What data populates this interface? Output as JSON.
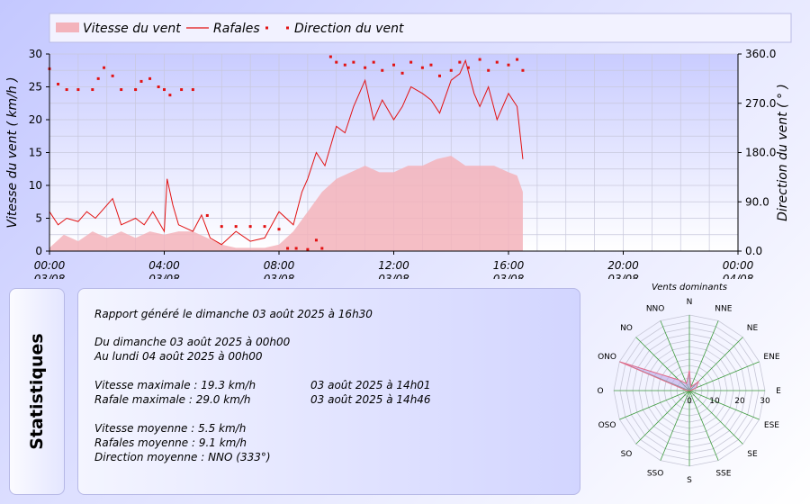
{
  "chart_data": [
    {
      "type": "area",
      "legend": {
        "placement": "top",
        "items": [
          {
            "name": "Vitesse du vent",
            "style": "filled-area",
            "color": "#f3b3bb"
          },
          {
            "name": "Rafales",
            "style": "line",
            "color": "#e21212"
          },
          {
            "name": "Direction du vent",
            "style": "points",
            "color": "#e21212"
          }
        ]
      },
      "ylabel": "Vitesse du vent ( km/h )",
      "ylabel_right": "Direction du vent ( ° )",
      "ylim": [
        0,
        30
      ],
      "ylim_right": [
        0,
        360
      ],
      "yticks": [
        "0",
        "5",
        "10",
        "15",
        "20",
        "25",
        "30"
      ],
      "yticks_right": [
        "0.0",
        "90.0",
        "180.0",
        "270.0",
        "360.0"
      ],
      "xlim_hours": [
        0,
        24
      ],
      "xticks": [
        {
          "time": "00:00",
          "date": "03/08"
        },
        {
          "time": "04:00",
          "date": "03/08"
        },
        {
          "time": "08:00",
          "date": "03/08"
        },
        {
          "time": "12:00",
          "date": "03/08"
        },
        {
          "time": "16:00",
          "date": "03/08"
        },
        {
          "time": "20:00",
          "date": "03/08"
        },
        {
          "time": "00:00",
          "date": "04/08"
        }
      ],
      "grid": true,
      "series": [
        {
          "name": "Vitesse du vent",
          "color": "#f3b3bb",
          "points": [
            [
              0,
              0.5
            ],
            [
              0.5,
              2.5
            ],
            [
              1,
              1.5
            ],
            [
              1.5,
              3
            ],
            [
              2,
              2
            ],
            [
              2.5,
              3
            ],
            [
              3,
              2
            ],
            [
              3.5,
              3
            ],
            [
              4,
              2.5
            ],
            [
              4.5,
              3
            ],
            [
              5,
              3
            ],
            [
              5.5,
              2
            ],
            [
              6,
              1
            ],
            [
              6.5,
              0.5
            ],
            [
              7,
              0.5
            ],
            [
              7.5,
              0.5
            ],
            [
              8,
              1
            ],
            [
              8.5,
              3
            ],
            [
              9,
              6
            ],
            [
              9.5,
              9
            ],
            [
              10,
              11
            ],
            [
              10.5,
              12
            ],
            [
              11,
              13
            ],
            [
              11.5,
              12
            ],
            [
              12,
              12
            ],
            [
              12.5,
              13
            ],
            [
              13,
              13
            ],
            [
              13.5,
              14
            ],
            [
              14,
              14.5
            ],
            [
              14.5,
              13
            ],
            [
              15,
              13
            ],
            [
              15.5,
              13
            ],
            [
              16,
              12
            ],
            [
              16.3,
              11.5
            ],
            [
              16.5,
              9
            ]
          ]
        },
        {
          "name": "Rafales",
          "color": "#e21212",
          "points": [
            [
              0,
              6
            ],
            [
              0.3,
              4
            ],
            [
              0.6,
              5
            ],
            [
              1,
              4.5
            ],
            [
              1.3,
              6
            ],
            [
              1.6,
              5
            ],
            [
              2,
              7
            ],
            [
              2.2,
              8
            ],
            [
              2.5,
              4
            ],
            [
              3,
              5
            ],
            [
              3.3,
              4
            ],
            [
              3.6,
              6
            ],
            [
              4,
              3
            ],
            [
              4.1,
              11
            ],
            [
              4.3,
              7
            ],
            [
              4.5,
              4
            ],
            [
              5,
              3
            ],
            [
              5.3,
              5.5
            ],
            [
              5.6,
              2
            ],
            [
              6,
              1
            ],
            [
              6.5,
              3
            ],
            [
              7,
              1.5
            ],
            [
              7.5,
              2
            ],
            [
              8,
              6
            ],
            [
              8.5,
              4
            ],
            [
              8.8,
              9
            ],
            [
              9,
              11
            ],
            [
              9.3,
              15
            ],
            [
              9.6,
              13
            ],
            [
              10,
              19
            ],
            [
              10.3,
              18
            ],
            [
              10.6,
              22
            ],
            [
              11,
              26
            ],
            [
              11.3,
              20
            ],
            [
              11.6,
              23
            ],
            [
              12,
              20
            ],
            [
              12.3,
              22
            ],
            [
              12.6,
              25
            ],
            [
              13,
              24
            ],
            [
              13.3,
              23
            ],
            [
              13.6,
              21
            ],
            [
              14,
              26
            ],
            [
              14.3,
              27
            ],
            [
              14.5,
              29
            ],
            [
              14.8,
              24
            ],
            [
              15,
              22
            ],
            [
              15.3,
              25
            ],
            [
              15.6,
              20
            ],
            [
              16,
              24
            ],
            [
              16.3,
              22
            ],
            [
              16.5,
              14
            ]
          ]
        },
        {
          "name": "Direction du vent",
          "color": "#e21212",
          "points": [
            [
              0,
              333
            ],
            [
              0.3,
              305
            ],
            [
              0.6,
              295
            ],
            [
              1,
              295
            ],
            [
              1.5,
              295
            ],
            [
              1.7,
              315
            ],
            [
              1.9,
              335
            ],
            [
              2.2,
              320
            ],
            [
              2.5,
              295
            ],
            [
              3,
              295
            ],
            [
              3.2,
              310
            ],
            [
              3.5,
              315
            ],
            [
              3.8,
              300
            ],
            [
              4,
              295
            ],
            [
              4.2,
              285
            ],
            [
              4.6,
              295
            ],
            [
              5,
              295
            ],
            [
              5.5,
              65
            ],
            [
              6,
              45
            ],
            [
              6.5,
              45
            ],
            [
              7,
              45
            ],
            [
              7.5,
              45
            ],
            [
              8,
              40
            ],
            [
              8.3,
              5
            ],
            [
              8.6,
              5
            ],
            [
              9,
              3
            ],
            [
              9.3,
              20
            ],
            [
              9.5,
              5
            ],
            [
              9.8,
              355
            ],
            [
              10,
              345
            ],
            [
              10.3,
              340
            ],
            [
              10.6,
              345
            ],
            [
              11,
              335
            ],
            [
              11.3,
              345
            ],
            [
              11.6,
              330
            ],
            [
              12,
              340
            ],
            [
              12.3,
              325
            ],
            [
              12.6,
              345
            ],
            [
              13,
              335
            ],
            [
              13.3,
              340
            ],
            [
              13.6,
              320
            ],
            [
              14,
              330
            ],
            [
              14.3,
              345
            ],
            [
              14.6,
              335
            ],
            [
              15,
              350
            ],
            [
              15.3,
              330
            ],
            [
              15.6,
              345
            ],
            [
              16,
              340
            ],
            [
              16.3,
              350
            ],
            [
              16.5,
              330
            ]
          ]
        }
      ]
    },
    {
      "type": "radar",
      "title": "Vents dominants",
      "directions": [
        "N",
        "NNE",
        "NE",
        "ENE",
        "E",
        "ESE",
        "SE",
        "SSE",
        "S",
        "SSO",
        "SO",
        "OSO",
        "O",
        "ONO",
        "NO",
        "NNO"
      ],
      "rings": [
        0,
        10,
        20,
        30
      ],
      "ring_labels": [
        "0",
        "10",
        "20",
        "30"
      ],
      "values": [
        8,
        1.5,
        5,
        3,
        0.5,
        0,
        0,
        0,
        0,
        0,
        0,
        0,
        1,
        30,
        6,
        3
      ]
    }
  ],
  "stats": {
    "title": "Statistiques",
    "report_line": "Rapport généré le dimanche 03 août 2025 à 16h30",
    "from_line": "Du dimanche 03 août 2025 à 00h00",
    "to_line": "Au lundi 04 août 2025 à 00h00",
    "max_speed_label": "Vitesse maximale : 19.3 km/h",
    "max_speed_time": "03 août 2025 à 14h01",
    "max_gust_label": "Rafale maximale : 29.0 km/h",
    "max_gust_time": "03 août 2025 à 14h46",
    "avg_speed": "Vitesse moyenne : 5.5 km/h",
    "avg_gust": "Rafales moyenne : 9.1 km/h",
    "avg_direction": "Direction moyenne : NNO (333°)"
  }
}
